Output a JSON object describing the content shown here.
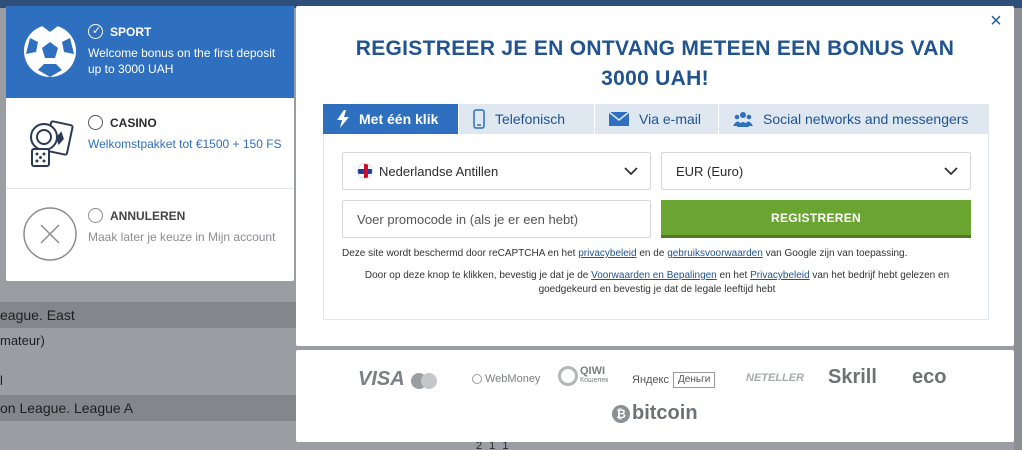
{
  "background": {
    "rows": [
      "eague. East",
      "mateur)",
      "on League. League A"
    ],
    "nums": "2 1 1"
  },
  "bonus": {
    "sport": {
      "title": "SPORT",
      "desc": "Welcome bonus on the first deposit up to 3000 UAH"
    },
    "casino": {
      "title": "CASINO",
      "desc": "Welkomstpakket tot €1500 + 150 FS"
    },
    "cancel": {
      "title": "ANNULEREN",
      "desc": "Maak later je keuze in Mijn account"
    }
  },
  "modal": {
    "title": "REGISTREER JE EN ONTVANG METEEN EEN BONUS VAN 3000 UAH!",
    "close": "×",
    "tabs": [
      {
        "label": "Met één klik",
        "icon": "lightning-icon"
      },
      {
        "label": "Telefonisch",
        "icon": "phone-icon"
      },
      {
        "label": "Via e-mail",
        "icon": "envelope-icon"
      },
      {
        "label": "Social networks and messengers",
        "icon": "people-icon"
      }
    ],
    "country": "Nederlandse Antillen",
    "currency": "EUR (Euro)",
    "promo_placeholder": "Voer promocode in (als je er een hebt)",
    "register": "REGISTREREN",
    "recaptcha": {
      "pre": "Deze site wordt beschermd door reCAPTCHA en het ",
      "link1": "privacybeleid",
      "mid": " en de ",
      "link2": "gebruiksvoorwaarden",
      "post": " van Google zijn van toepassing."
    },
    "terms": {
      "pre": "Door op deze knop te klikken, bevestig je dat je de ",
      "link1": "Voorwaarden en Bepalingen",
      "mid": " en het ",
      "link2": "Privacybeleid",
      "post": " van het bedrijf hebt gelezen en goedgekeurd en bevestig je dat de legale leeftijd hebt"
    }
  },
  "payments": {
    "visa": "VISA",
    "webmoney": "WebMoney",
    "qiwi": "QIWI",
    "qiwi_sub": "Кошелек",
    "yandex": "Яндекс",
    "yandex_money": "Деньги",
    "neteller": "NETELLER",
    "skrill": "Skrill",
    "eco": "eco",
    "bitcoin": "bitcoin"
  },
  "colors": {
    "accent": "#2f6fc0",
    "title": "#21548f",
    "register": "#6aa531"
  }
}
